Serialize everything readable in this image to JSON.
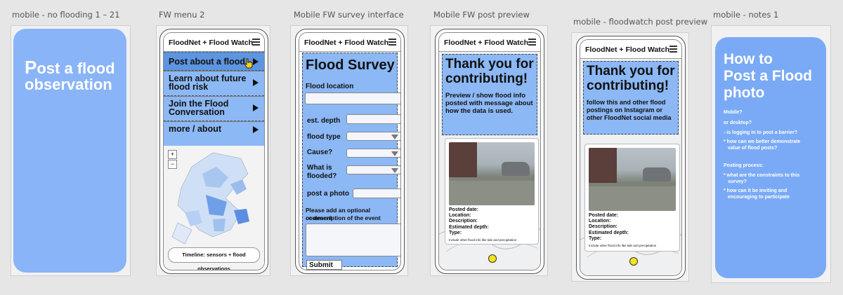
{
  "frames": [
    {
      "label": "mobile - no flooding 1 – 21"
    },
    {
      "label": "FW menu 2"
    },
    {
      "label": "Mobile FW survey interface"
    },
    {
      "label": "Mobile FW post preview"
    },
    {
      "label": "mobile - floodwatch post preview"
    },
    {
      "label": "mobile - notes 1"
    }
  ],
  "app_title": "FloodNet + Flood Watch",
  "screen1": {
    "heading_first_letter": "P",
    "heading_rest": "ost a flood",
    "heading_line2": "observation"
  },
  "menu": {
    "items": [
      {
        "line1": "Post about a flood",
        "line2": ""
      },
      {
        "line1": "Learn about future",
        "line2": "flood risk"
      },
      {
        "line1": "Join the Flood",
        "line2": "Conversation"
      },
      {
        "line1": "more / about",
        "line2": ""
      }
    ],
    "zoom_in": "+",
    "zoom_out": "−",
    "timeline_label": "Timeline: sensors + flood observations"
  },
  "survey": {
    "title": "Flood Survey",
    "location_label": "Flood location",
    "depth_label": "est. depth",
    "type_label": "flood type",
    "cause_label": "Cause?",
    "what_line1": "What is",
    "what_line2": "flooded?",
    "photo_label": "post a photo",
    "comment_line1": "Please add an optional comment",
    "comment_line2": "or description of the event",
    "submit_label": "Submit"
  },
  "preview1": {
    "line1": "Thank you for",
    "line2": "contributing!",
    "desc1": "Preview / show flood info",
    "desc2": "posted with message about",
    "desc3": "how the data is used."
  },
  "preview2": {
    "line1": "Thank you for",
    "line2": "contributing!",
    "desc1": "follow this and other flood",
    "desc2": "postings on Instagram or",
    "desc3": "other FloodNet social media"
  },
  "post": {
    "posted_date": "Posted date:",
    "location": "Location:",
    "description": "Description:",
    "estimated_depth": "Estimated depth:",
    "type": "Type:",
    "note": "Include other flood info like tide and precipitation"
  },
  "notes": {
    "title1": "How to",
    "title2": "Post a Flood",
    "title3": "photo",
    "items": [
      "Mobile?",
      "or desktop?",
      "- is logging in to post a barrier?",
      "* how can we better demonstrate",
      "value of flood posts?",
      "Posting process:",
      "* what are the constraints to this",
      "survey?",
      "* how can it be inviting and",
      "encouraging to participate"
    ]
  },
  "colors": {
    "panel_blue": "#8cb8f5",
    "notes_blue": "#7aaaf5",
    "screen_blue": "#8ab4f8"
  }
}
